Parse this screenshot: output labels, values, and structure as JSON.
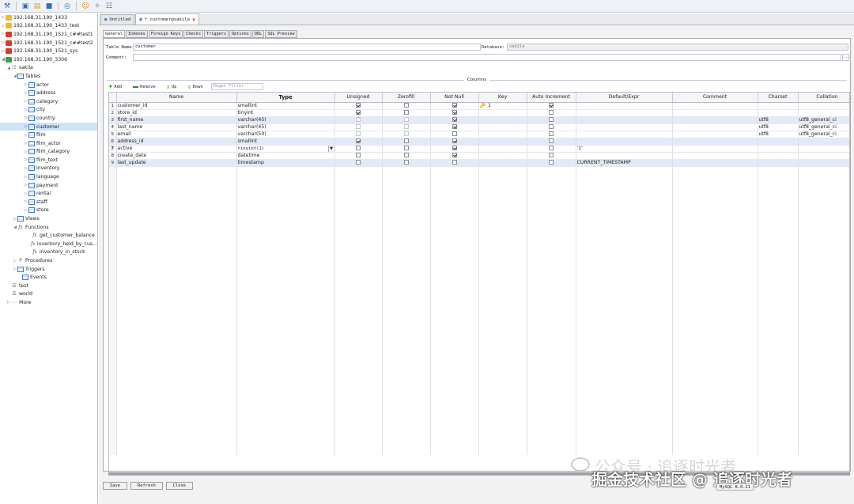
{
  "toolbar": {
    "icons": [
      "connect-icon",
      "new-query-icon",
      "open-icon",
      "save-icon",
      "binoculars-icon",
      "user-icon",
      "wand-icon",
      "clipboard-icon"
    ]
  },
  "sidebar": {
    "servers": [
      {
        "label": "192.168.31.190_1433",
        "type": "mssql"
      },
      {
        "label": "192.168.31.190_1433_test",
        "type": "mssql"
      },
      {
        "label": "192.168.31.190_1521_c##test1",
        "type": "oracle"
      },
      {
        "label": "192.168.31.190_1521_c##test2",
        "type": "oracle"
      },
      {
        "label": "192.168.31.190_1521_sys",
        "type": "oracle-sys"
      },
      {
        "label": "192.168.31.190_3306",
        "type": "mysql"
      }
    ],
    "database": "sakila",
    "tables_label": "Tables",
    "tables": [
      "actor",
      "address",
      "category",
      "city",
      "country",
      "customer",
      "film",
      "film_actor",
      "film_category",
      "film_text",
      "inventory",
      "language",
      "payment",
      "rental",
      "staff",
      "store"
    ],
    "selected_table": "customer",
    "views_label": "Views",
    "functions_label": "Functions",
    "functions": [
      "get_customer_balance",
      "inventory_held_by_cus...",
      "inventory_in_stock"
    ],
    "procedures_label": "Procedures",
    "triggers_label": "Triggers",
    "events_label": "Events",
    "other_dbs": [
      "test",
      "world"
    ],
    "more_label": "More"
  },
  "tabs": [
    {
      "label": "Untitled",
      "active": false
    },
    {
      "label": "* customer@sakila",
      "active": true
    }
  ],
  "subtabs": [
    "General",
    "Indexes",
    "Foreign Keys",
    "Checks",
    "Triggers",
    "Options",
    "DDL",
    "SQL Preview"
  ],
  "form": {
    "table_name_label": "Table Name:",
    "table_name": "customer",
    "database_label": "Database:",
    "database": "sakila",
    "comment_label": "Comment:",
    "comment": "",
    "comment_btn": "..."
  },
  "columns_section": {
    "title": "Columns",
    "add": "Add",
    "remove": "Remove",
    "up": "Up",
    "down": "Down",
    "filter_placeholder": "Regex Filter"
  },
  "grid": {
    "headers": [
      "",
      "Name",
      "Type",
      "Unsigned",
      "Zerofill",
      "Not Null",
      "Key",
      "Auto Increment",
      "Default/Expr",
      "Comment",
      "Charset",
      "Collation"
    ],
    "rows": [
      {
        "n": "1",
        "name": "customer_id",
        "type": "smallint",
        "unsigned": true,
        "zerofill": false,
        "notnull": true,
        "key": "1",
        "ai": true,
        "default": "",
        "comment": "",
        "charset": "",
        "collation": "",
        "hl": false
      },
      {
        "n": "2",
        "name": "store_id",
        "type": "tinyint",
        "unsigned": true,
        "zerofill": false,
        "notnull": true,
        "key": "",
        "ai": false,
        "default": "",
        "comment": "",
        "charset": "",
        "collation": "",
        "hl": false
      },
      {
        "n": "3",
        "name": "first_name",
        "type": "varchar(45)",
        "unsigned": false,
        "zerofill": false,
        "notnull": true,
        "key": "",
        "ai": false,
        "default": "",
        "comment": "",
        "charset": "utf8",
        "collation": "utf8_general_ci",
        "hl": true
      },
      {
        "n": "4",
        "name": "last_name",
        "type": "varchar(45)",
        "unsigned": false,
        "zerofill": false,
        "notnull": true,
        "key": "",
        "ai": false,
        "default": "",
        "comment": "",
        "charset": "utf8",
        "collation": "utf8_general_ci",
        "hl": false
      },
      {
        "n": "5",
        "name": "email",
        "type": "varchar(50)",
        "unsigned": false,
        "zerofill": false,
        "notnull": false,
        "key": "",
        "ai": false,
        "default": "",
        "comment": "",
        "charset": "utf8",
        "collation": "utf8_general_ci",
        "hl": false
      },
      {
        "n": "6",
        "name": "address_id",
        "type": "smallint",
        "unsigned": true,
        "zerofill": false,
        "notnull": true,
        "key": "",
        "ai": false,
        "default": "",
        "comment": "",
        "charset": "",
        "collation": "",
        "hl": true
      },
      {
        "n": "7",
        "name": "active",
        "type": "tinyint(1)",
        "unsigned": false,
        "zerofill": false,
        "notnull": true,
        "key": "",
        "ai": false,
        "default": "'1'",
        "comment": "",
        "charset": "",
        "collation": "",
        "hl": false,
        "editing": true
      },
      {
        "n": "8",
        "name": "create_date",
        "type": "datetime",
        "unsigned": false,
        "zerofill": false,
        "notnull": true,
        "key": "",
        "ai": false,
        "default": "",
        "comment": "",
        "charset": "",
        "collation": "",
        "hl": false
      },
      {
        "n": "9",
        "name": "last_update",
        "type": "timestamp",
        "unsigned": false,
        "zerofill": false,
        "notnull": false,
        "key": "",
        "ai": false,
        "default": "CURRENT_TIMESTAMP",
        "comment": "",
        "charset": "",
        "collation": "",
        "hl": true
      }
    ]
  },
  "buttons": {
    "save": "Save",
    "refresh": "Refresh",
    "close": "Close"
  },
  "status": {
    "version": "MySQL 8.0.21"
  },
  "watermark": {
    "line1": "公众号 · 追逐时光者",
    "line2": "掘金技术社区 @ 追逐时光者"
  }
}
